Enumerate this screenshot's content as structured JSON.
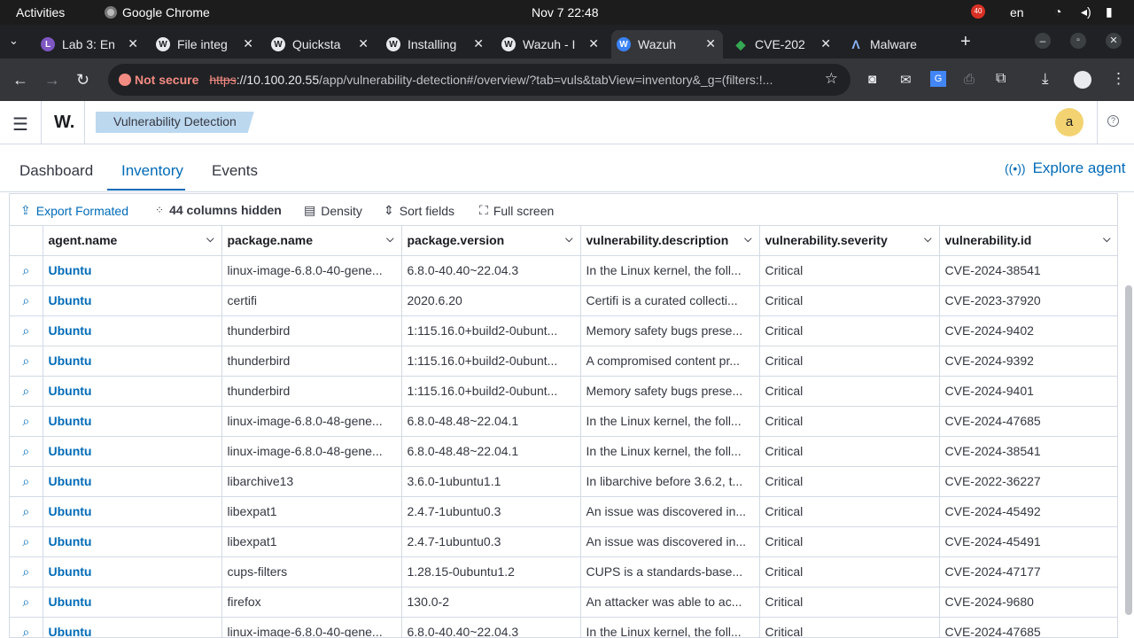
{
  "os_bar": {
    "activities": "Activities",
    "app": "Google Chrome",
    "clock": "Nov 7  22:48",
    "lang": "en",
    "badge": "40"
  },
  "browser_tabs": [
    {
      "favicon": "L",
      "title": "Lab 3: En"
    },
    {
      "favicon": "W",
      "title": "File integ"
    },
    {
      "favicon": "W",
      "title": "Quicksta"
    },
    {
      "favicon": "W",
      "title": "Installing"
    },
    {
      "favicon": "W",
      "title": "Wazuh - I"
    },
    {
      "favicon": "W",
      "title": "Wazuh"
    },
    {
      "favicon": "◆",
      "title": "CVE-202"
    },
    {
      "favicon": "Λ",
      "title": "Malware"
    }
  ],
  "address_bar": {
    "security": "Not secure",
    "https": "https",
    "host": "://10.100.20.55",
    "path": "/app/vulnerability-detection#/overview/?tab=vuls&tabView=inventory&_g=(filters:!..."
  },
  "app": {
    "logo": "W.",
    "breadcrumb": "Vulnerability Detection",
    "avatar": "a"
  },
  "page_tabs": [
    "Dashboard",
    "Inventory",
    "Events"
  ],
  "explore_agent": "Explore agent",
  "toolbar": {
    "export": "Export Formated",
    "hidden": "44 columns hidden",
    "density": "Density",
    "sort": "Sort fields",
    "fullscreen": "Full screen"
  },
  "columns": [
    "agent.name",
    "package.name",
    "package.version",
    "vulnerability.description",
    "vulnerability.severity",
    "vulnerability.id"
  ],
  "rows": [
    [
      "Ubuntu",
      "linux-image-6.8.0-40-gene...",
      "6.8.0-40.40~22.04.3",
      "In the Linux kernel, the foll...",
      "Critical",
      "CVE-2024-38541"
    ],
    [
      "Ubuntu",
      "certifi",
      "2020.6.20",
      "Certifi is a curated collecti...",
      "Critical",
      "CVE-2023-37920"
    ],
    [
      "Ubuntu",
      "thunderbird",
      "1:115.16.0+build2-0ubunt...",
      "Memory safety bugs prese...",
      "Critical",
      "CVE-2024-9402"
    ],
    [
      "Ubuntu",
      "thunderbird",
      "1:115.16.0+build2-0ubunt...",
      "A compromised content pr...",
      "Critical",
      "CVE-2024-9392"
    ],
    [
      "Ubuntu",
      "thunderbird",
      "1:115.16.0+build2-0ubunt...",
      "Memory safety bugs prese...",
      "Critical",
      "CVE-2024-9401"
    ],
    [
      "Ubuntu",
      "linux-image-6.8.0-48-gene...",
      "6.8.0-48.48~22.04.1",
      "In the Linux kernel, the foll...",
      "Critical",
      "CVE-2024-47685"
    ],
    [
      "Ubuntu",
      "linux-image-6.8.0-48-gene...",
      "6.8.0-48.48~22.04.1",
      "In the Linux kernel, the foll...",
      "Critical",
      "CVE-2024-38541"
    ],
    [
      "Ubuntu",
      "libarchive13",
      "3.6.0-1ubuntu1.1",
      "In libarchive before 3.6.2, t...",
      "Critical",
      "CVE-2022-36227"
    ],
    [
      "Ubuntu",
      "libexpat1",
      "2.4.7-1ubuntu0.3",
      "An issue was discovered in...",
      "Critical",
      "CVE-2024-45492"
    ],
    [
      "Ubuntu",
      "libexpat1",
      "2.4.7-1ubuntu0.3",
      "An issue was discovered in...",
      "Critical",
      "CVE-2024-45491"
    ],
    [
      "Ubuntu",
      "cups-filters",
      "1.28.15-0ubuntu1.2",
      "CUPS is a standards-base...",
      "Critical",
      "CVE-2024-47177"
    ],
    [
      "Ubuntu",
      "firefox",
      "130.0-2",
      "An attacker was able to ac...",
      "Critical",
      "CVE-2024-9680"
    ],
    [
      "Ubuntu",
      "linux-image-6.8.0-40-gene...",
      "6.8.0-40.40~22.04.3",
      "In the Linux kernel, the foll...",
      "Critical",
      "CVE-2024-47685"
    ]
  ],
  "colors": {
    "accent": "#006bb8",
    "chrome_dark": "#202124",
    "chrome_mid": "#35363a",
    "breadcrumb_bg": "#bcd8ef"
  }
}
